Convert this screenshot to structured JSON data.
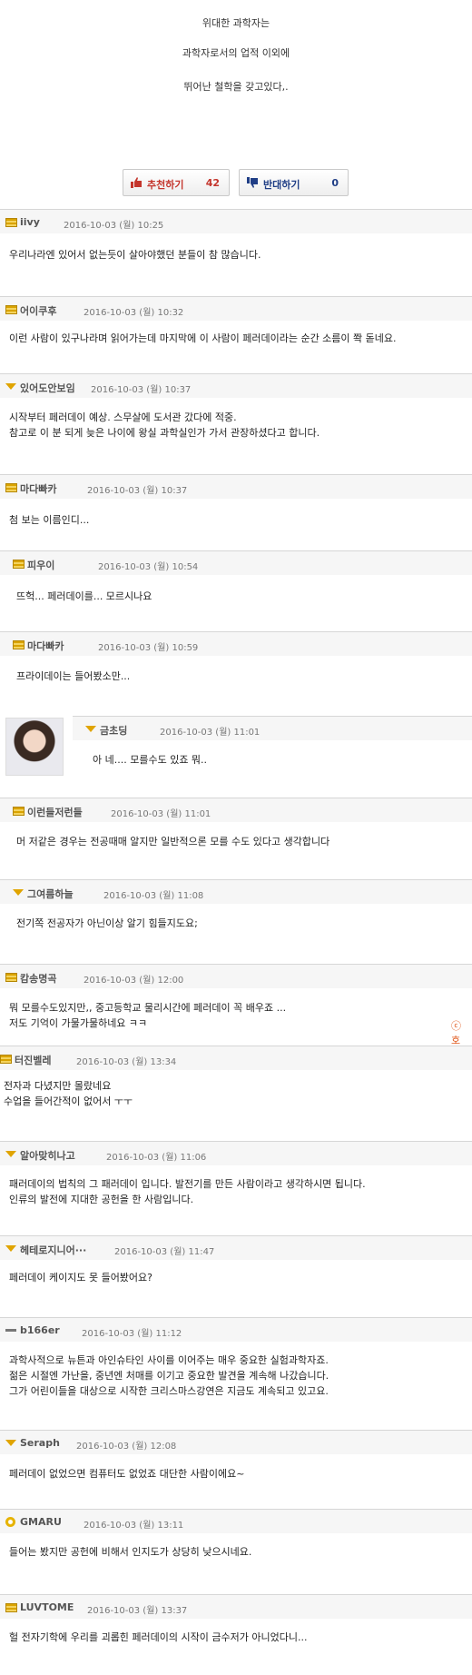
{
  "intro": [
    "위대한 과학자는",
    "과학자로서의 업적 이외에",
    "뛰어난 철학을 갖고있다,."
  ],
  "votes": {
    "up_label": "추천하기",
    "up_count": "42",
    "down_label": "반대하기",
    "down_count": "0",
    "up_icon": "thumbs-up-icon",
    "down_icon": "thumbs-down-icon"
  },
  "comments": [
    {
      "nick": "iivy",
      "time": "2016-10-03 (월) 10:25",
      "level_icon": "level-bars-icon",
      "lines": [
        "우리나라엔 있어서 없는듯이 살아야했던 분들이 참 많습니다."
      ]
    },
    {
      "nick": "어이쿠후",
      "time": "2016-10-03 (월) 10:32",
      "level_icon": "level-bars-icon",
      "lines": [
        "이런 사람이 있구나라며 읽어가는데 마지막에 이 사람이 페러데이라는 순간 소름이 쫙 돋네요."
      ]
    },
    {
      "nick": "있어도안보임",
      "time": "2016-10-03 (월) 10:37",
      "level_icon": "level-chevron-icon",
      "lines": [
        "시작부터 페러데이 예상. 스무살에 도서관 갔다에 적중.",
        "참고로 이 분 되게 늦은 나이에 왕실 과학실인가 가서 관장하셨다고 합니다."
      ]
    },
    {
      "nick": "마다빠카",
      "time": "2016-10-03 (월) 10:37",
      "level_icon": "level-bars-icon",
      "lines": [
        "첨 보는 이름인디..."
      ]
    },
    {
      "nick": "피우이",
      "time": "2016-10-03 (월) 10:54",
      "level_icon": "level-bars-icon",
      "lines": [
        "뜨헉... 페러데이를... 모르시나요"
      ]
    },
    {
      "nick": "마다빠카",
      "time": "2016-10-03 (월) 10:59",
      "level_icon": "level-bars-icon",
      "lines": [
        "프라이데이는 들어봤소만..."
      ]
    },
    {
      "nick": "금초딩",
      "time": "2016-10-03 (월) 11:01",
      "level_icon": "level-chevron-icon",
      "lines": [
        "아 네.... 모를수도 있죠 뭐.."
      ]
    },
    {
      "nick": "이런들저런들",
      "time": "2016-10-03 (월) 11:01",
      "level_icon": "level-bars-icon",
      "lines": [
        "머 저같은 경우는 전공때매 알지만 일반적으론 모를 수도 있다고 생각합니다"
      ]
    },
    {
      "nick": "그여름하늘",
      "time": "2016-10-03 (월) 11:08",
      "level_icon": "level-chevron-icon",
      "lines": [
        "전기쪽 전공자가 아닌이상 알기 힘들지도요;"
      ]
    },
    {
      "nick": "캄송명곡",
      "time": "2016-10-03 (월) 12:00",
      "level_icon": "level-bars-icon",
      "lines": [
        "뭐 모를수도있지만,, 중고등학교 물리시간에 페러데이 꼭 배우죠 ...",
        "저도 기억이 가물가물하네요 ㅋㅋ"
      ]
    },
    {
      "nick": "터진벨레",
      "time": "2016-10-03 (월) 13:34",
      "level_icon": "level-bars-icon",
      "lines": [
        "전자과 다녔지만 몰랐네요",
        "수업을 들어간적이 없어서 ㅜㅜ"
      ]
    },
    {
      "nick": "알아맞히나고",
      "time": "2016-10-03 (월) 11:06",
      "level_icon": "level-chevron-icon",
      "lines": [
        "패러데이의 법칙의 그 패러데이 입니다. 발전기를 만든 사람이라고 생각하시면 됩니다.",
        "인류의 발전에 지대한 공헌을 한 사람입니다."
      ]
    },
    {
      "nick": "헤테로지니어···",
      "time": "2016-10-03 (월) 11:47",
      "level_icon": "level-chevron-icon",
      "lines": [
        "페러데이 케이지도 못 들어봤어요?"
      ]
    },
    {
      "nick": "b166er",
      "time": "2016-10-03 (월) 11:12",
      "level_icon": "level-dash-icon",
      "lines": [
        "과학사적으로 뉴튼과 아인슈타인 사이를 이어주는 매우 중요한 실험과학자죠.",
        "젊은 시절엔 가난을, 중년엔 처매를 이기고 중요한 발견을 계속해 나갔습니다.",
        "그가 어린이들을 대상으로 시작한 크리스마스강연은 지금도 계속되고 있고요."
      ]
    },
    {
      "nick": "Seraph",
      "time": "2016-10-03 (월) 12:08",
      "level_icon": "level-chevron-icon",
      "lines": [
        "페러데이 없었으면 컴퓨터도 없었죠 대단한 사람이에요~"
      ]
    },
    {
      "nick": "GMARU",
      "time": "2016-10-03 (월) 13:11",
      "level_icon": "level-gear-icon",
      "lines": [
        "들어는 봤지만 공헌에 비해서 인지도가 상당히 낮으시네요."
      ]
    },
    {
      "nick": "LUVTOME",
      "time": "2016-10-03 (월) 13:37",
      "level_icon": "level-bars-icon",
      "lines": [
        "헐 전자기학에 우리를 괴롭힌 페러데이의 시작이 금수저가 아니었다니..."
      ]
    }
  ],
  "side_glyph": "ⓒ 호",
  "avatar_icon": "profile-photo-avatar"
}
